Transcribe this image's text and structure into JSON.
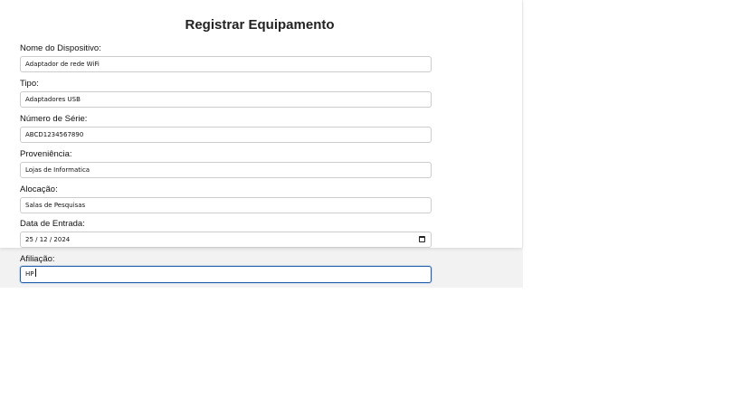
{
  "form": {
    "title": "Registrar Equipamento",
    "fields": [
      {
        "label": "Nome do Dispositivo:",
        "value": "Adaptador de rede WiFi"
      },
      {
        "label": "Tipo:",
        "value": "Adaptadores USB"
      },
      {
        "label": "Número de Série:",
        "value": "ABCD1234567890"
      },
      {
        "label": "Proveniência:",
        "value": "Lojas de Informatica"
      },
      {
        "label": "Alocação:",
        "value": "Salas de Pesquisas"
      },
      {
        "label": "Data de Entrada:",
        "value": "25 / 12 / 2024"
      },
      {
        "label": "Afiliação:",
        "value": "HP"
      }
    ]
  },
  "icons": {
    "date_picker": "calendar-icon"
  },
  "colors": {
    "focus_border": "#1f5fae",
    "page_background": "#f2f2f2",
    "card_background": "#ffffff"
  }
}
